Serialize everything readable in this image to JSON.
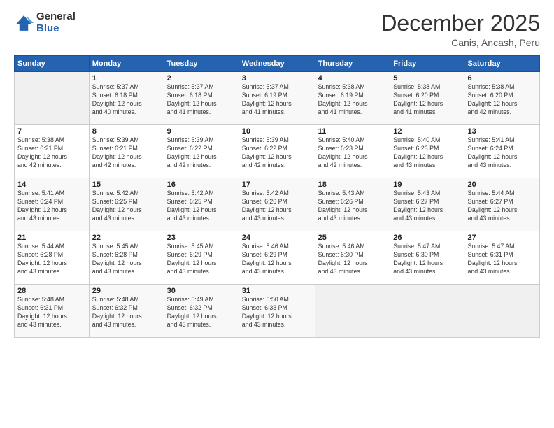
{
  "logo": {
    "general": "General",
    "blue": "Blue"
  },
  "title": "December 2025",
  "location": "Canis, Ancash, Peru",
  "days_header": [
    "Sunday",
    "Monday",
    "Tuesday",
    "Wednesday",
    "Thursday",
    "Friday",
    "Saturday"
  ],
  "weeks": [
    [
      {
        "day": "",
        "info": ""
      },
      {
        "day": "1",
        "info": "Sunrise: 5:37 AM\nSunset: 6:18 PM\nDaylight: 12 hours\nand 40 minutes."
      },
      {
        "day": "2",
        "info": "Sunrise: 5:37 AM\nSunset: 6:18 PM\nDaylight: 12 hours\nand 41 minutes."
      },
      {
        "day": "3",
        "info": "Sunrise: 5:37 AM\nSunset: 6:19 PM\nDaylight: 12 hours\nand 41 minutes."
      },
      {
        "day": "4",
        "info": "Sunrise: 5:38 AM\nSunset: 6:19 PM\nDaylight: 12 hours\nand 41 minutes."
      },
      {
        "day": "5",
        "info": "Sunrise: 5:38 AM\nSunset: 6:20 PM\nDaylight: 12 hours\nand 41 minutes."
      },
      {
        "day": "6",
        "info": "Sunrise: 5:38 AM\nSunset: 6:20 PM\nDaylight: 12 hours\nand 42 minutes."
      }
    ],
    [
      {
        "day": "7",
        "info": "Sunrise: 5:38 AM\nSunset: 6:21 PM\nDaylight: 12 hours\nand 42 minutes."
      },
      {
        "day": "8",
        "info": "Sunrise: 5:39 AM\nSunset: 6:21 PM\nDaylight: 12 hours\nand 42 minutes."
      },
      {
        "day": "9",
        "info": "Sunrise: 5:39 AM\nSunset: 6:22 PM\nDaylight: 12 hours\nand 42 minutes."
      },
      {
        "day": "10",
        "info": "Sunrise: 5:39 AM\nSunset: 6:22 PM\nDaylight: 12 hours\nand 42 minutes."
      },
      {
        "day": "11",
        "info": "Sunrise: 5:40 AM\nSunset: 6:23 PM\nDaylight: 12 hours\nand 42 minutes."
      },
      {
        "day": "12",
        "info": "Sunrise: 5:40 AM\nSunset: 6:23 PM\nDaylight: 12 hours\nand 43 minutes."
      },
      {
        "day": "13",
        "info": "Sunrise: 5:41 AM\nSunset: 6:24 PM\nDaylight: 12 hours\nand 43 minutes."
      }
    ],
    [
      {
        "day": "14",
        "info": "Sunrise: 5:41 AM\nSunset: 6:24 PM\nDaylight: 12 hours\nand 43 minutes."
      },
      {
        "day": "15",
        "info": "Sunrise: 5:42 AM\nSunset: 6:25 PM\nDaylight: 12 hours\nand 43 minutes."
      },
      {
        "day": "16",
        "info": "Sunrise: 5:42 AM\nSunset: 6:25 PM\nDaylight: 12 hours\nand 43 minutes."
      },
      {
        "day": "17",
        "info": "Sunrise: 5:42 AM\nSunset: 6:26 PM\nDaylight: 12 hours\nand 43 minutes."
      },
      {
        "day": "18",
        "info": "Sunrise: 5:43 AM\nSunset: 6:26 PM\nDaylight: 12 hours\nand 43 minutes."
      },
      {
        "day": "19",
        "info": "Sunrise: 5:43 AM\nSunset: 6:27 PM\nDaylight: 12 hours\nand 43 minutes."
      },
      {
        "day": "20",
        "info": "Sunrise: 5:44 AM\nSunset: 6:27 PM\nDaylight: 12 hours\nand 43 minutes."
      }
    ],
    [
      {
        "day": "21",
        "info": "Sunrise: 5:44 AM\nSunset: 6:28 PM\nDaylight: 12 hours\nand 43 minutes."
      },
      {
        "day": "22",
        "info": "Sunrise: 5:45 AM\nSunset: 6:28 PM\nDaylight: 12 hours\nand 43 minutes."
      },
      {
        "day": "23",
        "info": "Sunrise: 5:45 AM\nSunset: 6:29 PM\nDaylight: 12 hours\nand 43 minutes."
      },
      {
        "day": "24",
        "info": "Sunrise: 5:46 AM\nSunset: 6:29 PM\nDaylight: 12 hours\nand 43 minutes."
      },
      {
        "day": "25",
        "info": "Sunrise: 5:46 AM\nSunset: 6:30 PM\nDaylight: 12 hours\nand 43 minutes."
      },
      {
        "day": "26",
        "info": "Sunrise: 5:47 AM\nSunset: 6:30 PM\nDaylight: 12 hours\nand 43 minutes."
      },
      {
        "day": "27",
        "info": "Sunrise: 5:47 AM\nSunset: 6:31 PM\nDaylight: 12 hours\nand 43 minutes."
      }
    ],
    [
      {
        "day": "28",
        "info": "Sunrise: 5:48 AM\nSunset: 6:31 PM\nDaylight: 12 hours\nand 43 minutes."
      },
      {
        "day": "29",
        "info": "Sunrise: 5:48 AM\nSunset: 6:32 PM\nDaylight: 12 hours\nand 43 minutes."
      },
      {
        "day": "30",
        "info": "Sunrise: 5:49 AM\nSunset: 6:32 PM\nDaylight: 12 hours\nand 43 minutes."
      },
      {
        "day": "31",
        "info": "Sunrise: 5:50 AM\nSunset: 6:33 PM\nDaylight: 12 hours\nand 43 minutes."
      },
      {
        "day": "",
        "info": ""
      },
      {
        "day": "",
        "info": ""
      },
      {
        "day": "",
        "info": ""
      }
    ]
  ]
}
